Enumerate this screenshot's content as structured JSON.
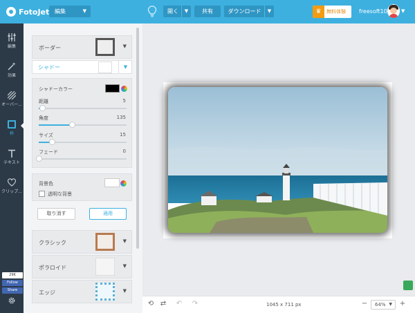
{
  "header": {
    "app_name": "FotoJet",
    "mode": "編集",
    "open_label": "開く",
    "share_label": "共有",
    "download_label": "ダウンロード",
    "trial_label": "無料体験",
    "username": "freesoft100"
  },
  "leftnav": {
    "items": [
      {
        "label": "編集",
        "icon": "sliders-icon"
      },
      {
        "label": "効果",
        "icon": "magic-wand-icon"
      },
      {
        "label": "オーバー...",
        "icon": "overlay-stripes-icon"
      },
      {
        "label": "枠",
        "icon": "frame-icon"
      },
      {
        "label": "テキスト",
        "icon": "text-icon"
      },
      {
        "label": "クリップ...",
        "icon": "heart-icon"
      }
    ],
    "fb_count": "29K",
    "fb_follow": "Follow",
    "fb_share": "Share"
  },
  "panel": {
    "border_title": "ボーダー",
    "shadow_title": "シャドー",
    "shadow_color_label": "シャドーカラー",
    "shadow_color": "#000000",
    "distance_label": "距離",
    "distance_value": "5",
    "distance_level": 0.04,
    "angle_label": "角度",
    "angle_value": "135",
    "angle_level": 0.375,
    "size_label": "サイズ",
    "size_value": "15",
    "size_level": 0.15,
    "fade_label": "フェード",
    "fade_value": "0",
    "fade_level": 0.0,
    "bg_color_label": "背景色",
    "bg_color": "#ffffff",
    "transparent_bg_label": "透明な背景",
    "cancel_label": "取り消す",
    "apply_label": "適用",
    "presets": [
      "クラシック",
      "ポラロイド",
      "エッジ"
    ]
  },
  "canvas": {
    "dimensions": "1045 x 711 px",
    "zoom": "64%"
  },
  "colors": {
    "accent": "#3db0e0",
    "nav_bg": "#2c3a47",
    "trial": "#f39c12"
  }
}
